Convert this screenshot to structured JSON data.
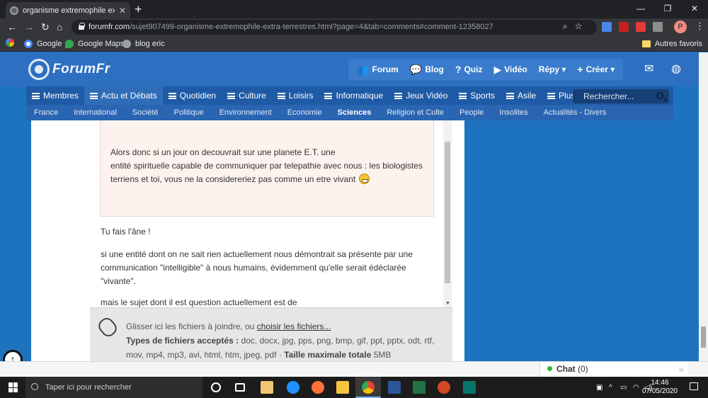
{
  "browser": {
    "tab_title": "organisme extremophile extra te",
    "url_host": "forumfr.com",
    "url_path": "/sujet907499-organisme-extremophile-extra-terrestres.html?page=4&tab=comments#comment-12358027",
    "bookmarks": [
      "Applications",
      "Google",
      "Google Maps",
      "blog eric"
    ],
    "bookmarks_right": "Autres favoris",
    "avatar_letter": "P"
  },
  "site": {
    "logo": "ForumFr",
    "topnav": [
      {
        "label": "Forum",
        "glyph": "👥"
      },
      {
        "label": "Blog",
        "glyph": "💬"
      },
      {
        "label": "Quiz",
        "glyph": "?"
      },
      {
        "label": "Vidéo",
        "glyph": "▶"
      },
      {
        "label": "Répy ▾",
        "glyph": ""
      },
      {
        "label": "Créer ▾",
        "glyph": "+"
      }
    ],
    "categories": [
      "Membres",
      "Actu et Débats",
      "Quotidien",
      "Culture",
      "Loisirs",
      "Informatique",
      "Jeux Vidéo",
      "Sports",
      "Asile",
      "Plus"
    ],
    "active_category": "Actu et Débats",
    "search_placeholder": "Rechercher...",
    "subcategories": [
      "France",
      "International",
      "Société",
      "Politique",
      "Environnement",
      "Economie",
      "Sciences",
      "Religion et Culte",
      "People",
      "Insolites",
      "Actualités - Divers"
    ],
    "active_subcategory": "Sciences"
  },
  "post": {
    "quote_line1": "Alors donc si un jour on decouvrait sur une planete E.T. une",
    "quote_line2": "entité spirituelle capable de communiquer par telepathie avec nous : les biologistes",
    "quote_line3": "terriens et toi, vous ne la considereriez pas comme un etre vivant",
    "reply1": "Tu fais l'âne !",
    "reply2": " si une entité dont on ne sait rien actuellement nous démontrait sa présente par une communication \"intelligible\" à nous humains, évidemment qu'elle serait édéclarée \"vivante\".",
    "reply3": "mais le sujet dont il est question actuellement est de"
  },
  "attach": {
    "drop_text": "Glisser ici les fichiers à joindre, ou ",
    "choose_link": "choisir les fichiers...",
    "types_label": "Types de fichiers acceptés : ",
    "types": "doc, docx, jpg, pps, png, bmp, gif, ppt, pptx, odt, rtf, mov, mp4, mp3, avi, html, htm, jpeg, pdf",
    "sep": " · ",
    "max_label": "Taille maximale totale ",
    "max_value": "5MB"
  },
  "chat": {
    "label": "Chat",
    "count": "(0)"
  },
  "taskbar": {
    "search_placeholder": "Taper ici pour rechercher",
    "time": "14:46",
    "date": "07/05/2020"
  }
}
